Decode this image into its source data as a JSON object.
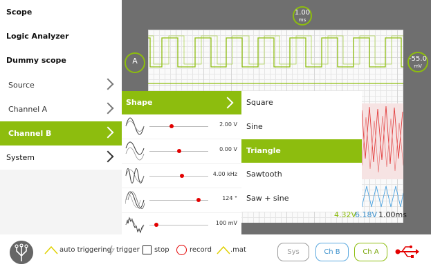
{
  "menu": {
    "top_items": [
      "Scope",
      "Logic Analyzer",
      "Dummy scope"
    ],
    "sub_items": [
      "Source",
      "Channel A",
      "Channel B",
      "System"
    ],
    "active_item": "Channel B"
  },
  "scope": {
    "time_marker": {
      "value": "1.00",
      "unit": "ms"
    },
    "channel_marker": "A",
    "volt_marker": {
      "value": "-55.0",
      "unit": "mV"
    }
  },
  "shape_panel": {
    "header": "Shape",
    "rows": [
      {
        "icon": "amplitude-wave-icon",
        "value": "2.00 V",
        "level": 0.38
      },
      {
        "icon": "offset-wave-icon",
        "value": "0.00 V",
        "level": 0.5
      },
      {
        "icon": "frequency-wave-icon",
        "value": "4.00 kHz",
        "level": 0.55
      },
      {
        "icon": "phase-wave-icon",
        "value": "124 °",
        "level": 0.84
      },
      {
        "icon": "noise-wave-icon",
        "value": "100 mV",
        "level": 0.12
      }
    ]
  },
  "shape_options": {
    "items": [
      "Square",
      "Sine",
      "Triangle",
      "Sawtooth",
      "Saw + sine"
    ],
    "selected": "Triangle"
  },
  "readouts": {
    "ch_a": "4.32V",
    "ch_b": "6.18V",
    "time": "1.00ms"
  },
  "bottom_bar": {
    "auto_triggering": "auto triggering",
    "trigger": "trigger",
    "stop": "stop",
    "record": "record",
    "mat": ".mat",
    "sys_button": "Sys",
    "chb_button": "Ch B",
    "cha_button": "Ch A"
  },
  "colors": {
    "accent": "#8dbd0e",
    "channel_b": "#3b90cc",
    "record": "#e30000"
  }
}
